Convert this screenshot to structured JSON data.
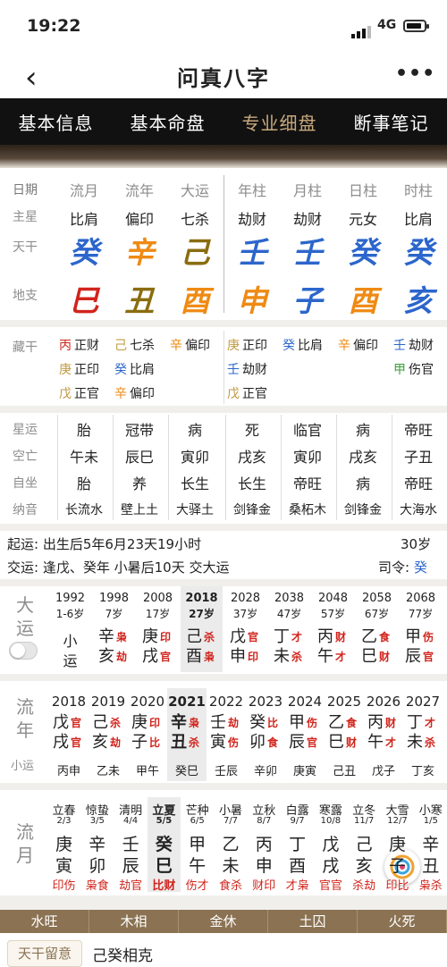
{
  "status": {
    "time": "19:22",
    "network": "4G"
  },
  "nav": {
    "title": "问真八字",
    "more": "•••"
  },
  "tabs": [
    {
      "label": "基本信息",
      "active": false
    },
    {
      "label": "基本命盘",
      "active": false
    },
    {
      "label": "专业细盘",
      "active": true
    },
    {
      "label": "断事笔记",
      "active": false
    }
  ],
  "labels": {
    "date": "日期",
    "main_star": "主星",
    "tiangan": "天干",
    "dizhi": "地支",
    "canggan": "藏干",
    "xingyun": "星运",
    "kongwang": "空亡",
    "zizuo": "自坐",
    "nayin": "纳音",
    "dayun": "大运",
    "liunian": "流年",
    "xiaoyun": "小运",
    "liuyue": "流月"
  },
  "columns": [
    {
      "head": "流月",
      "star": "比肩",
      "gan": "癸",
      "gan_color": "#2c66cc",
      "zhi": "巳",
      "zhi_color": "#d1241c",
      "canggan": [
        {
          "g": "丙",
          "gc": "#d1241c",
          "s": "正财"
        },
        {
          "g": "庚",
          "gc": "#c19a42",
          "s": "正印"
        },
        {
          "g": "戊",
          "gc": "#c19a42",
          "s": "正官"
        }
      ],
      "xingyun": "胎",
      "kongwang": "午未",
      "zizuo": "胎",
      "nayin": "长流水"
    },
    {
      "head": "流年",
      "star": "偏印",
      "gan": "辛",
      "gan_color": "#ef8a14",
      "zhi": "丑",
      "zhi_color": "#8a6d10",
      "canggan": [
        {
          "g": "己",
          "gc": "#c19a42",
          "s": "七杀"
        },
        {
          "g": "癸",
          "gc": "#2c66cc",
          "s": "比肩"
        },
        {
          "g": "辛",
          "gc": "#ef8a14",
          "s": "偏印"
        }
      ],
      "xingyun": "冠带",
      "kongwang": "辰巳",
      "zizuo": "养",
      "nayin": "壁上土"
    },
    {
      "head": "大运",
      "star": "七杀",
      "gan": "己",
      "gan_color": "#8a6d10",
      "zhi": "酉",
      "zhi_color": "#ef8a14",
      "canggan": [
        {
          "g": "辛",
          "gc": "#ef8a14",
          "s": "偏印"
        }
      ],
      "xingyun": "病",
      "kongwang": "寅卯",
      "zizuo": "长生",
      "nayin": "大驿土"
    },
    {
      "head": "年柱",
      "star": "劫财",
      "gan": "壬",
      "gan_color": "#2c66cc",
      "zhi": "申",
      "zhi_color": "#ef8a14",
      "canggan": [
        {
          "g": "庚",
          "gc": "#c19a42",
          "s": "正印"
        },
        {
          "g": "壬",
          "gc": "#2c66cc",
          "s": "劫财"
        },
        {
          "g": "戊",
          "gc": "#c19a42",
          "s": "正官"
        }
      ],
      "xingyun": "死",
      "kongwang": "戌亥",
      "zizuo": "长生",
      "nayin": "剑锋金"
    },
    {
      "head": "月柱",
      "star": "劫财",
      "gan": "壬",
      "gan_color": "#2c66cc",
      "zhi": "子",
      "zhi_color": "#2c66cc",
      "canggan": [
        {
          "g": "癸",
          "gc": "#2c66cc",
          "s": "比肩"
        }
      ],
      "xingyun": "临官",
      "kongwang": "寅卯",
      "zizuo": "帝旺",
      "nayin": "桑柘木"
    },
    {
      "head": "日柱",
      "star": "元女",
      "gan": "癸",
      "gan_color": "#2c66cc",
      "zhi": "酉",
      "zhi_color": "#ef8a14",
      "canggan": [
        {
          "g": "辛",
          "gc": "#ef8a14",
          "s": "偏印"
        }
      ],
      "xingyun": "病",
      "kongwang": "戌亥",
      "zizuo": "病",
      "nayin": "剑锋金"
    },
    {
      "head": "时柱",
      "star": "比肩",
      "gan": "癸",
      "gan_color": "#2c66cc",
      "zhi": "亥",
      "zhi_color": "#2c66cc",
      "canggan": [
        {
          "g": "壬",
          "gc": "#2c66cc",
          "s": "劫财"
        },
        {
          "g": "甲",
          "gc": "#3ba03b",
          "s": "伤官"
        }
      ],
      "xingyun": "帝旺",
      "kongwang": "子丑",
      "zizuo": "帝旺",
      "nayin": "大海水"
    }
  ],
  "qiyun": {
    "label": "起运:",
    "text": "出生后5年6月23天19小时",
    "age": "30岁"
  },
  "jiaoyun": {
    "label": "交运:",
    "text": "逢戊、癸年 小暑后10天 交大运",
    "siling_label": "司令:",
    "siling": "癸"
  },
  "dayun": [
    {
      "year": "1992",
      "age": "1-6岁",
      "top": "小",
      "bottom": "运",
      "t1": "",
      "t2": "",
      "mode": "small"
    },
    {
      "year": "1998",
      "age": "7岁",
      "top": "辛",
      "bottom": "亥",
      "t1": "枭",
      "t2": "劫",
      "tc": "#d1241c",
      "gc": "#222"
    },
    {
      "year": "2008",
      "age": "17岁",
      "top": "庚",
      "bottom": "戌",
      "t1": "印",
      "t2": "官",
      "tc": "#d1241c",
      "gc": "#222"
    },
    {
      "year": "2018",
      "age": "27岁",
      "top": "己",
      "bottom": "酉",
      "t1": "杀",
      "t2": "枭",
      "tc": "#d1241c",
      "gc": "#222",
      "hl": true
    },
    {
      "year": "2028",
      "age": "37岁",
      "top": "戊",
      "bottom": "申",
      "t1": "官",
      "t2": "印",
      "tc": "#d1241c",
      "gc": "#222"
    },
    {
      "year": "2038",
      "age": "47岁",
      "top": "丁",
      "bottom": "未",
      "t1": "才",
      "t2": "杀",
      "tc": "#d1241c",
      "gc": "#222"
    },
    {
      "year": "2048",
      "age": "57岁",
      "top": "丙",
      "bottom": "午",
      "t1": "财",
      "t2": "才",
      "tc": "#d1241c",
      "gc": "#222"
    },
    {
      "year": "2058",
      "age": "67岁",
      "top": "乙",
      "bottom": "巳",
      "t1": "食",
      "t2": "财",
      "tc": "#d1241c",
      "gc": "#222"
    },
    {
      "year": "2068",
      "age": "77岁",
      "top": "甲",
      "bottom": "辰",
      "t1": "伤",
      "t2": "官",
      "tc": "#d1241c",
      "gc": "#222"
    }
  ],
  "liunian": [
    {
      "year": "2018",
      "top": "戊",
      "bottom": "戌",
      "t1": "官",
      "t2": "官",
      "xy": "丙申"
    },
    {
      "year": "2019",
      "top": "己",
      "bottom": "亥",
      "t1": "杀",
      "t2": "劫",
      "xy": "乙未"
    },
    {
      "year": "2020",
      "top": "庚",
      "bottom": "子",
      "t1": "印",
      "t2": "比",
      "xy": "甲午"
    },
    {
      "year": "2021",
      "top": "辛",
      "bottom": "丑",
      "t1": "枭",
      "t2": "杀",
      "xy": "癸巳",
      "hl": true
    },
    {
      "year": "2022",
      "top": "壬",
      "bottom": "寅",
      "t1": "劫",
      "t2": "伤",
      "xy": "壬辰"
    },
    {
      "year": "2023",
      "top": "癸",
      "bottom": "卯",
      "t1": "比",
      "t2": "食",
      "xy": "辛卯"
    },
    {
      "year": "2024",
      "top": "甲",
      "bottom": "辰",
      "t1": "伤",
      "t2": "官",
      "xy": "庚寅"
    },
    {
      "year": "2025",
      "top": "乙",
      "bottom": "巳",
      "t1": "食",
      "t2": "财",
      "xy": "己丑"
    },
    {
      "year": "2026",
      "top": "丙",
      "bottom": "午",
      "t1": "财",
      "t2": "才",
      "xy": "戊子"
    },
    {
      "year": "2027",
      "top": "丁",
      "bottom": "未",
      "t1": "才",
      "t2": "杀",
      "xy": "丁亥"
    }
  ],
  "liuyue": [
    {
      "jie": "立春",
      "date": "2/3",
      "top": "庚",
      "bottom": "寅",
      "ss": "印伤"
    },
    {
      "jie": "惊蛰",
      "date": "3/5",
      "top": "辛",
      "bottom": "卯",
      "ss": "枭食"
    },
    {
      "jie": "清明",
      "date": "4/4",
      "top": "壬",
      "bottom": "辰",
      "ss": "劫官"
    },
    {
      "jie": "立夏",
      "date": "5/5",
      "top": "癸",
      "bottom": "巳",
      "ss": "比财",
      "hl": true
    },
    {
      "jie": "芒种",
      "date": "6/5",
      "top": "甲",
      "bottom": "午",
      "ss": "伤才"
    },
    {
      "jie": "小暑",
      "date": "7/7",
      "top": "乙",
      "bottom": "未",
      "ss": "食杀"
    },
    {
      "jie": "立秋",
      "date": "8/7",
      "top": "丙",
      "bottom": "申",
      "ss": "财印"
    },
    {
      "jie": "白露",
      "date": "9/7",
      "top": "丁",
      "bottom": "酉",
      "ss": "才枭"
    },
    {
      "jie": "寒露",
      "date": "10/8",
      "top": "戊",
      "bottom": "戌",
      "ss": "官官"
    },
    {
      "jie": "立冬",
      "date": "11/7",
      "top": "己",
      "bottom": "亥",
      "ss": "杀劫"
    },
    {
      "jie": "大雪",
      "date": "12/7",
      "top": "庚",
      "bottom": "子",
      "ss": "印比"
    },
    {
      "jie": "小寒",
      "date": "1/5",
      "top": "辛",
      "bottom": "丑",
      "ss": "枭杀"
    }
  ],
  "wuxing": [
    "水旺",
    "木相",
    "金休",
    "土囚",
    "火死"
  ],
  "footer": {
    "tab": "天干留意",
    "text": "己癸相克"
  }
}
